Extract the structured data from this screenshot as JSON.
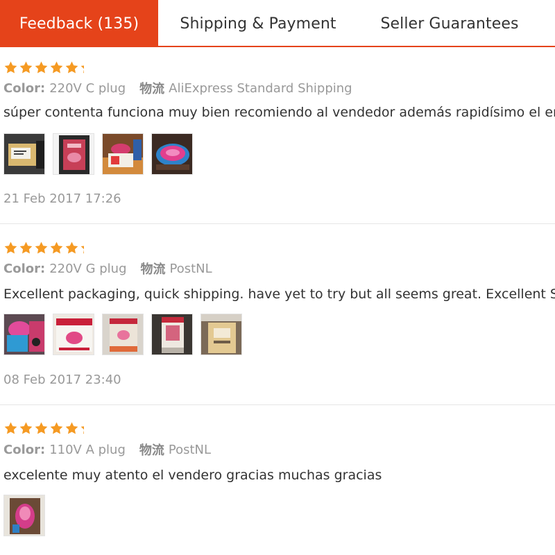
{
  "tabs": [
    {
      "label": "Feedback (135)",
      "active": true
    },
    {
      "label": "Shipping & Payment",
      "active": false
    },
    {
      "label": "Seller Guarantees",
      "active": false
    }
  ],
  "colors": {
    "accent": "#e5431a",
    "star": "#f59a23"
  },
  "reviews": [
    {
      "rating": 5,
      "color_label": "Color:",
      "color_value": "220V C plug",
      "shipping_label": "物流",
      "shipping_value": "AliExpress Standard Shipping",
      "comment": "súper contenta funciona muy bien recomiendo al vendedor además rapidísimo el envío",
      "photo_count": 4,
      "date": "21 Feb 2017 17:26"
    },
    {
      "rating": 5,
      "color_label": "Color:",
      "color_value": "220V G plug",
      "shipping_label": "物流",
      "shipping_value": "PostNL",
      "comment": "Excellent packaging, quick shipping. have yet to try but all seems great. Excellent Seller",
      "photo_count": 5,
      "date": "08 Feb 2017 23:40"
    },
    {
      "rating": 5,
      "color_label": "Color:",
      "color_value": "110V A plug",
      "shipping_label": "物流",
      "shipping_value": "PostNL",
      "comment": "excelente muy atento el vendero gracias muchas gracias",
      "photo_count": 1
    }
  ]
}
